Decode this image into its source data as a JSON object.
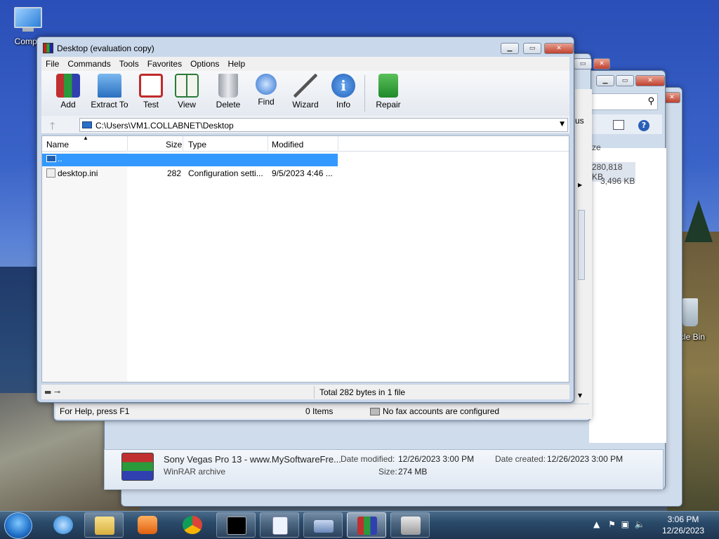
{
  "desktop": {
    "icons": [
      {
        "label": "Compu"
      },
      {
        "label": "cle Bin"
      }
    ]
  },
  "winrar": {
    "title": "Desktop (evaluation copy)",
    "menu": [
      "File",
      "Commands",
      "Tools",
      "Favorites",
      "Options",
      "Help"
    ],
    "toolbar": [
      {
        "label": "Add",
        "icon": "add-archive-icon"
      },
      {
        "label": "Extract To",
        "icon": "extract-folder-icon"
      },
      {
        "label": "Test",
        "icon": "test-checklist-icon"
      },
      {
        "label": "View",
        "icon": "view-book-icon"
      },
      {
        "label": "Delete",
        "icon": "trash-icon"
      },
      {
        "label": "Find",
        "icon": "magnifier-icon"
      },
      {
        "label": "Wizard",
        "icon": "wand-icon"
      },
      {
        "label": "Info",
        "icon": "info-icon"
      },
      {
        "label": "Repair",
        "icon": "repair-icon"
      }
    ],
    "address": "C:\\Users\\VM1.COLLABNET\\Desktop",
    "columns": [
      "Name",
      "Size",
      "Type",
      "Modified"
    ],
    "rows": [
      {
        "name": "..",
        "size": "",
        "type": "",
        "modified": ""
      },
      {
        "name": "desktop.ini",
        "size": "282",
        "type": "Configuration setti...",
        "modified": "9/5/2023 4:46 ..."
      }
    ],
    "status_total": "Total 282 bytes in 1 file"
  },
  "bg_window": {
    "status_help": "For Help, press F1",
    "status_items": "0 Items",
    "status_fax": "No fax accounts are configured",
    "right_col_header": "ze",
    "right_sizes": [
      "280,818 KB",
      "3,496 KB"
    ],
    "right_us": "us"
  },
  "details_pane": {
    "name": "Sony Vegas Pro 13 - www.MySoftwareFre...",
    "type": "WinRAR archive",
    "date_modified_label": "Date modified:",
    "date_modified": "12/26/2023 3:00 PM",
    "date_created_label": "Date created:",
    "date_created": "12/26/2023 3:00 PM",
    "size_label": "Size:",
    "size": "274 MB"
  },
  "taskbar": {
    "time": "3:06 PM",
    "date": "12/26/2023"
  }
}
